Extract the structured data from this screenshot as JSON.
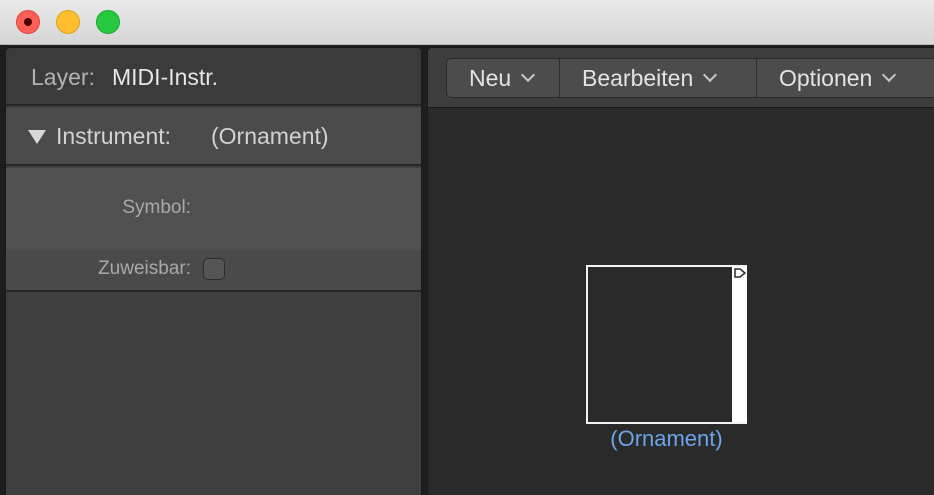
{
  "window": {
    "controls": [
      "close",
      "minimize",
      "zoom"
    ]
  },
  "inspector": {
    "layer_label": "Layer:",
    "layer_value": "MIDI-Instr.",
    "section_label": "Instrument:",
    "section_value": "(Ornament)",
    "symbol_label": "Symbol:",
    "assignable_label": "Zuweisbar:",
    "assignable_checked": false
  },
  "menubar": {
    "items": [
      {
        "label": "Neu"
      },
      {
        "label": "Bearbeiten"
      },
      {
        "label": "Optionen"
      }
    ]
  },
  "canvas": {
    "object_name": "(Ornament)",
    "label_color": "#6ea3ea"
  }
}
